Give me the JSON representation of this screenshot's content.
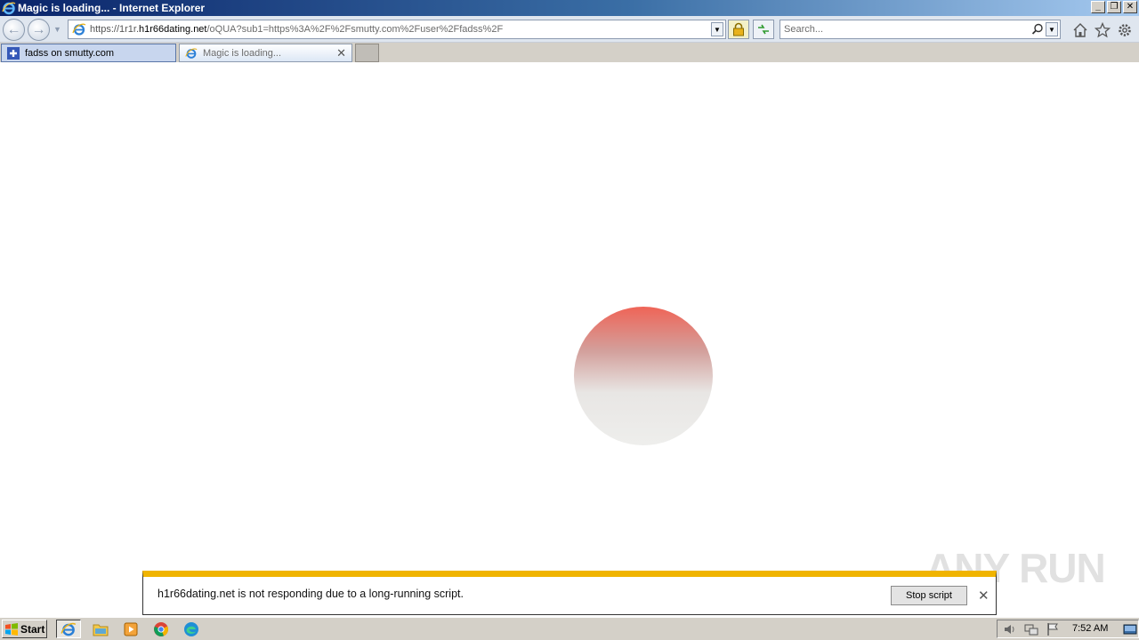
{
  "window": {
    "title": "Magic is loading... - Internet Explorer",
    "buttons": {
      "minimize": "_",
      "restore": "❐",
      "close": "✕"
    }
  },
  "navbar": {
    "back_icon": "←",
    "forward_icon": "→",
    "url_scheme": "https://1r1r.",
    "url_host": "h1r66dating.net",
    "url_path": "/oQUA?sub1=https%3A%2F%2Fsmutty.com%2Fuser%2Ffadss%2F",
    "search_placeholder": "Search..."
  },
  "tabs": [
    {
      "label": "fadss on smutty.com",
      "active": true
    },
    {
      "label": "Magic is loading...",
      "active": false,
      "close": "✕"
    }
  ],
  "notification": {
    "message": "h1r66dating.net is not responding due to a long-running script.",
    "button_label": "Stop script",
    "close": "✕"
  },
  "watermark": "ANY RUN",
  "taskbar": {
    "start_label": "Start",
    "clock": "7:52 AM",
    "apps": [
      "internet-explorer",
      "file-explorer",
      "media-player",
      "chrome",
      "edge"
    ]
  },
  "colors": {
    "notification_accent": "#f0b400",
    "loader_top": "#ef6457",
    "loader_bottom": "#eeeeec"
  }
}
